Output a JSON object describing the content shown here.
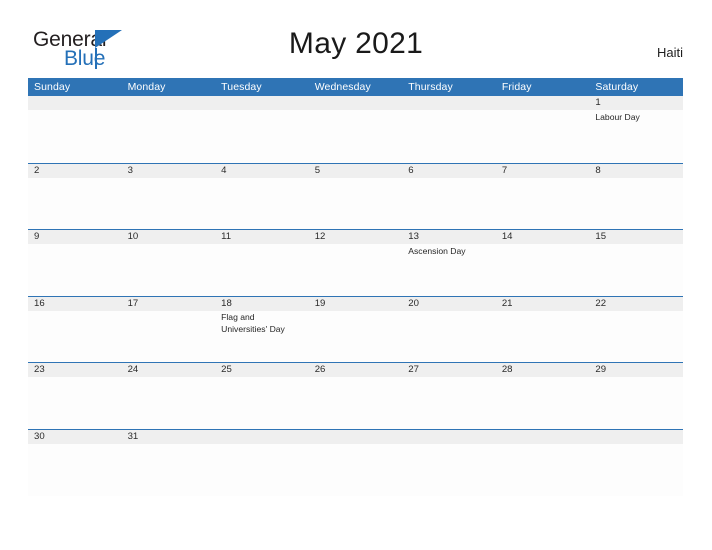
{
  "header": {
    "logo": {
      "word_one": "General",
      "word_two": "Blue",
      "triangle_icon": "logo-triangle-icon",
      "brand_color": "#2470b8",
      "text_color": "#231f20"
    },
    "title": "May 2021",
    "region": "Haiti"
  },
  "calendar": {
    "accent_color": "#2f74b5",
    "date_band_color": "#efefef",
    "day_names": [
      "Sunday",
      "Monday",
      "Tuesday",
      "Wednesday",
      "Thursday",
      "Friday",
      "Saturday"
    ],
    "weeks": [
      [
        {
          "date": "",
          "event": ""
        },
        {
          "date": "",
          "event": ""
        },
        {
          "date": "",
          "event": ""
        },
        {
          "date": "",
          "event": ""
        },
        {
          "date": "",
          "event": ""
        },
        {
          "date": "",
          "event": ""
        },
        {
          "date": "1",
          "event": "Labour Day"
        }
      ],
      [
        {
          "date": "2",
          "event": ""
        },
        {
          "date": "3",
          "event": ""
        },
        {
          "date": "4",
          "event": ""
        },
        {
          "date": "5",
          "event": ""
        },
        {
          "date": "6",
          "event": ""
        },
        {
          "date": "7",
          "event": ""
        },
        {
          "date": "8",
          "event": ""
        }
      ],
      [
        {
          "date": "9",
          "event": ""
        },
        {
          "date": "10",
          "event": ""
        },
        {
          "date": "11",
          "event": ""
        },
        {
          "date": "12",
          "event": ""
        },
        {
          "date": "13",
          "event": "Ascension Day"
        },
        {
          "date": "14",
          "event": ""
        },
        {
          "date": "15",
          "event": ""
        }
      ],
      [
        {
          "date": "16",
          "event": ""
        },
        {
          "date": "17",
          "event": ""
        },
        {
          "date": "18",
          "event": "Flag and Universities' Day"
        },
        {
          "date": "19",
          "event": ""
        },
        {
          "date": "20",
          "event": ""
        },
        {
          "date": "21",
          "event": ""
        },
        {
          "date": "22",
          "event": ""
        }
      ],
      [
        {
          "date": "23",
          "event": ""
        },
        {
          "date": "24",
          "event": ""
        },
        {
          "date": "25",
          "event": ""
        },
        {
          "date": "26",
          "event": ""
        },
        {
          "date": "27",
          "event": ""
        },
        {
          "date": "28",
          "event": ""
        },
        {
          "date": "29",
          "event": ""
        }
      ],
      [
        {
          "date": "30",
          "event": ""
        },
        {
          "date": "31",
          "event": ""
        },
        {
          "date": "",
          "event": ""
        },
        {
          "date": "",
          "event": ""
        },
        {
          "date": "",
          "event": ""
        },
        {
          "date": "",
          "event": ""
        },
        {
          "date": "",
          "event": ""
        }
      ]
    ]
  }
}
